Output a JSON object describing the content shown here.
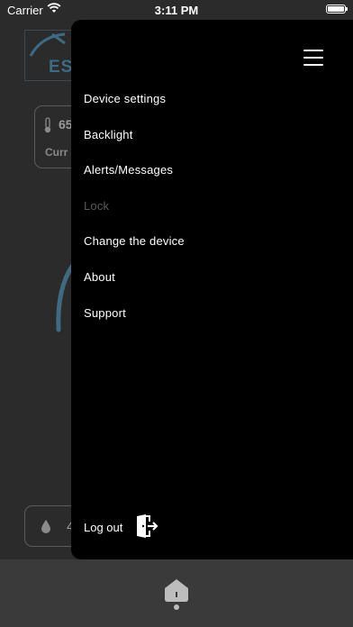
{
  "status_bar": {
    "carrier": "Carrier",
    "time": "3:11 PM",
    "battery_level": 1.0
  },
  "background": {
    "logo_text": "ES",
    "temperature": {
      "value": "65",
      "label": "Curr"
    },
    "humidity": {
      "value": "4"
    }
  },
  "drawer": {
    "menu_icon": "hamburger-icon",
    "items": [
      {
        "label": "Device settings",
        "enabled": true
      },
      {
        "label": "Backlight",
        "enabled": true
      },
      {
        "label": "Alerts/Messages",
        "enabled": true
      },
      {
        "label": "Lock",
        "enabled": false
      },
      {
        "label": "Change the device",
        "enabled": true
      },
      {
        "label": "About",
        "enabled": true
      },
      {
        "label": "Support",
        "enabled": true
      }
    ],
    "logout": {
      "label": "Log out",
      "icon": "logout-door-icon"
    }
  },
  "tab_bar": {
    "icon": "home-icon"
  },
  "colors": {
    "drawer_bg": "#000000",
    "dimmed_bg": "#2b2b2b",
    "accent": "#3d6b86",
    "disabled": "#5a5a5a"
  }
}
